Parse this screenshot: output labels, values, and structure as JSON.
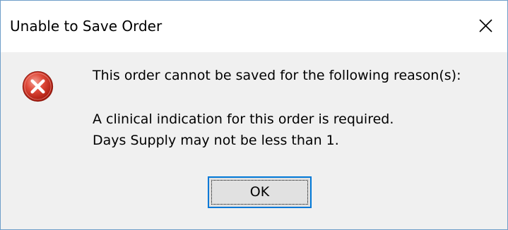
{
  "dialog": {
    "title": "Unable to Save Order",
    "close_icon": "close-icon",
    "icon": "error-icon",
    "message_heading": "This order cannot be saved for the following reason(s):",
    "reasons": [
      "A clinical indication for this order is required.",
      "Days Supply may not be less than 1."
    ],
    "ok_label": "OK"
  },
  "colors": {
    "titlebar_bg": "#ffffff",
    "body_bg": "#f0f0f0",
    "window_border": "#6f9ec9",
    "button_bg": "#e1e1e1",
    "button_focus_border": "#0078d7",
    "error_red": "#c42b1c"
  }
}
